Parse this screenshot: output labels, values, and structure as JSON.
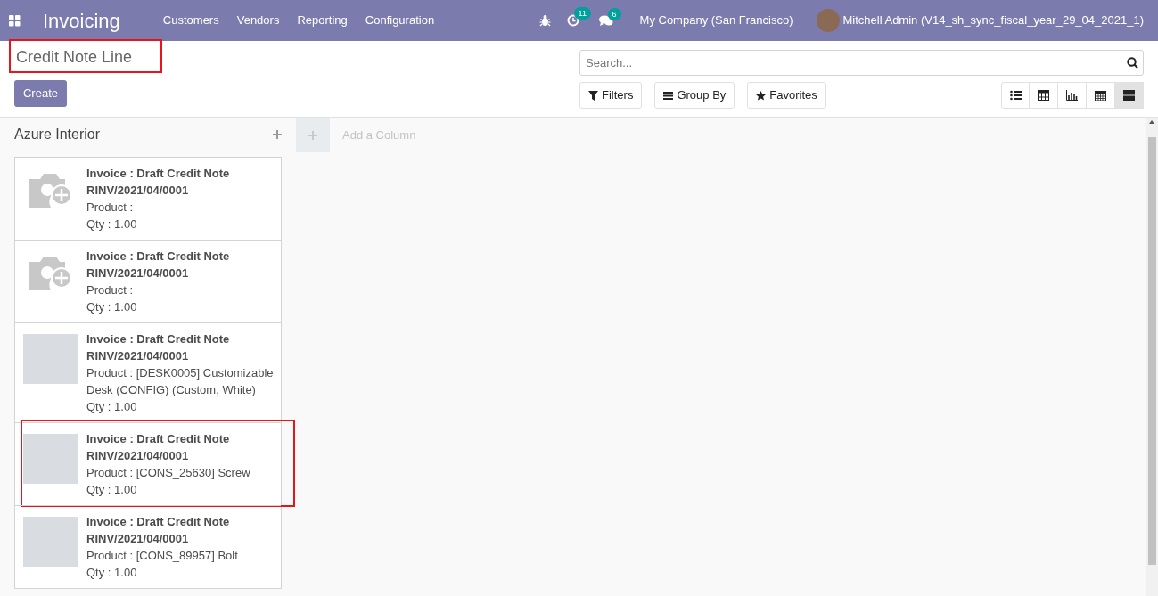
{
  "navbar": {
    "app_title": "Invoicing",
    "menu": [
      "Customers",
      "Vendors",
      "Reporting",
      "Configuration"
    ],
    "activities_count": "11",
    "messages_count": "6",
    "company": "My Company (San Francisco)",
    "user": "Mitchell Admin (V14_sh_sync_fiscal_year_29_04_2021_1)"
  },
  "control_panel": {
    "title": "Credit Note Line",
    "title_highlighted": true,
    "create_button": "Create",
    "search": {
      "placeholder": "Search..."
    },
    "filters": [
      {
        "kind": "filter",
        "label": "Filters"
      },
      {
        "kind": "group",
        "label": "Group By"
      },
      {
        "kind": "favorite",
        "label": "Favorites"
      }
    ],
    "views": [
      {
        "kind": "list",
        "selected": false
      },
      {
        "kind": "pivot",
        "selected": false
      },
      {
        "kind": "graph",
        "selected": false
      },
      {
        "kind": "calendar",
        "selected": false
      },
      {
        "kind": "kanban",
        "selected": true
      }
    ]
  },
  "kanban": {
    "column": {
      "title": "Azure Interior",
      "cards": [
        {
          "kind": "camera",
          "highlighted": false,
          "title": "Invoice : Draft Credit Note",
          "reference": "RINV/2021/04/0001",
          "product": "Product :",
          "qty": "Qty : 1.00"
        },
        {
          "kind": "camera",
          "highlighted": false,
          "title": "Invoice : Draft Credit Note",
          "reference": "RINV/2021/04/0001",
          "product": "Product :",
          "qty": "Qty : 1.00"
        },
        {
          "kind": "photo",
          "highlighted": false,
          "title": "Invoice : Draft Credit Note",
          "reference": "RINV/2021/04/0001",
          "product": "Product : [DESK0005] Customizable Desk (CONFIG) (Custom, White)",
          "qty": "Qty : 1.00"
        },
        {
          "kind": "photo",
          "highlighted": true,
          "title": "Invoice : Draft Credit Note",
          "reference": "RINV/2021/04/0001",
          "product": "Product : [CONS_25630] Screw",
          "qty": "Qty : 1.00"
        },
        {
          "kind": "photo",
          "highlighted": false,
          "title": "Invoice : Draft Credit Note",
          "reference": "RINV/2021/04/0001",
          "product": "Product : [CONS_89957] Bolt",
          "qty": "Qty : 1.00"
        }
      ]
    },
    "add_column": "Add a Column"
  }
}
